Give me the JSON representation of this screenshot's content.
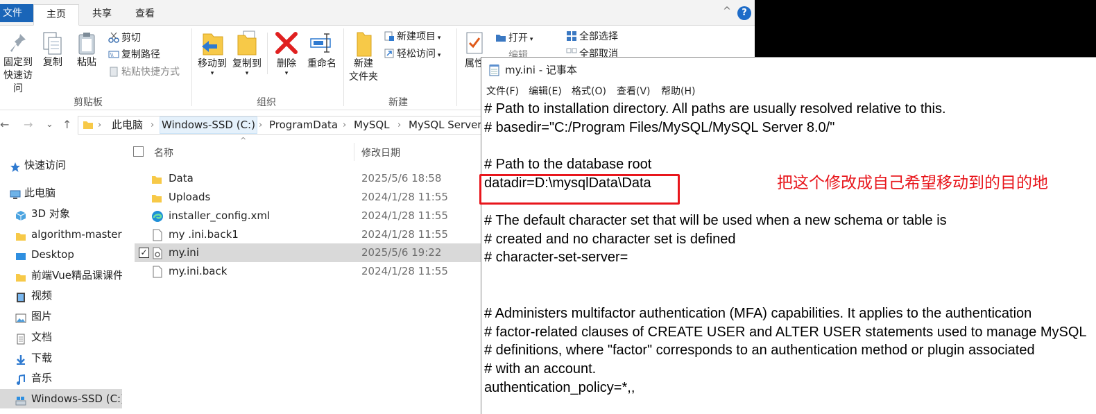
{
  "explorer": {
    "tabs": {
      "file": "文件",
      "home": "主页",
      "share": "共享",
      "view": "查看"
    },
    "help_label": "?",
    "collapse_label": "^",
    "ribbon": {
      "clipboard": {
        "pin_line1": "固定到",
        "pin_line2": "快速访问",
        "copy": "复制",
        "paste": "粘贴",
        "cut": "剪切",
        "copy_path": "复制路径",
        "paste_shortcut": "粘贴快捷方式",
        "group": "剪贴板"
      },
      "organize": {
        "move_to": "移动到",
        "copy_to": "复制到",
        "delete": "删除",
        "rename": "重命名",
        "group": "组织"
      },
      "new": {
        "new_folder_line1": "新建",
        "new_folder_line2": "文件夹",
        "new_item": "新建项目",
        "easy_access": "轻松访问",
        "group": "新建"
      },
      "open": {
        "properties": "属性",
        "open": "打开",
        "edit": "编辑"
      },
      "select": {
        "select_all": "全部选择",
        "select_none": "全部取消"
      }
    },
    "address": {
      "back": "←",
      "forward": "→",
      "recent": "⌄",
      "up": "↑",
      "crumbs": [
        "此电脑",
        "Windows-SSD (C:)",
        "ProgramData",
        "MySQL",
        "MySQL Server"
      ]
    },
    "nav": [
      {
        "label": "快速访问",
        "icon": "star-icon"
      },
      {
        "label": "此电脑",
        "icon": "computer-icon"
      },
      {
        "label": "3D 对象",
        "icon": "cube-icon"
      },
      {
        "label": "algorithm-master",
        "icon": "folder-icon"
      },
      {
        "label": "Desktop",
        "icon": "desktop-icon"
      },
      {
        "label": "前端Vue精品课课件",
        "icon": "folder-icon"
      },
      {
        "label": "视频",
        "icon": "video-icon"
      },
      {
        "label": "图片",
        "icon": "picture-icon"
      },
      {
        "label": "文档",
        "icon": "document-icon"
      },
      {
        "label": "下载",
        "icon": "download-icon"
      },
      {
        "label": "音乐",
        "icon": "music-icon"
      },
      {
        "label": "Windows-SSD (C:)",
        "icon": "drive-icon"
      }
    ],
    "columns": {
      "name": "名称",
      "modified": "修改日期"
    },
    "files": [
      {
        "name": "Data",
        "date": "2025/5/6 18:58",
        "icon": "folder-icon"
      },
      {
        "name": "Uploads",
        "date": "2024/1/28 11:55",
        "icon": "folder-icon"
      },
      {
        "name": "installer_config.xml",
        "date": "2024/1/28 11:55",
        "icon": "edge-icon"
      },
      {
        "name": "my .ini.back1",
        "date": "2024/1/28 11:55",
        "icon": "file-icon"
      },
      {
        "name": "my.ini",
        "date": "2025/5/6 19:22",
        "icon": "settings-file-icon",
        "selected": true
      },
      {
        "name": "my.ini.back",
        "date": "2024/1/28 11:55",
        "icon": "file-icon"
      }
    ]
  },
  "notepad": {
    "title": "my.ini - 记事本",
    "menu": [
      "文件(F)",
      "编辑(E)",
      "格式(O)",
      "查看(V)",
      "帮助(H)"
    ],
    "lines": [
      "# Path to installation directory. All paths are usually resolved relative to this.",
      "# basedir=\"C:/Program Files/MySQL/MySQL Server 8.0/\"",
      "",
      "# Path to the database root",
      "datadir=D:\\mysqlData\\Data",
      "",
      "# The default character set that will be used when a new schema or table is",
      "# created and no character set is defined",
      "# character-set-server=",
      "",
      "",
      "# Administers multifactor authentication (MFA) capabilities. It applies to the authentication",
      "# factor-related clauses of CREATE USER and ALTER USER statements used to manage MySQL",
      "# definitions, where \"factor\" corresponds to an authentication method or plugin associated",
      "# with an account.",
      "authentication_policy=*,,"
    ]
  },
  "annotation": "把这个修改成自己希望移动到的目的地",
  "colors": {
    "accent": "#1a65b8",
    "annotation_red": "#e8161c",
    "selection": "#d9d9d9"
  }
}
